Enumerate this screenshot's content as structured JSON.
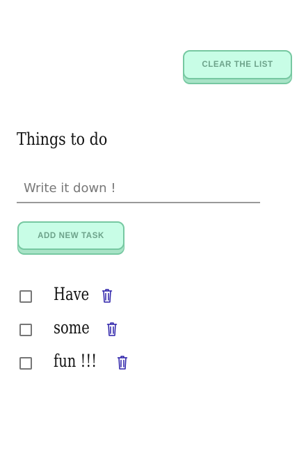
{
  "header": {
    "clear_label": "Clear the list"
  },
  "todo": {
    "title": "Things to do",
    "input": {
      "placeholder": "Write it down !",
      "value": ""
    },
    "add_label": "Add new task",
    "tasks": [
      {
        "text": "Have",
        "checked": false
      },
      {
        "text": "some",
        "checked": false
      },
      {
        "text": "fun !!!",
        "checked": false
      }
    ]
  },
  "colors": {
    "button_bg": "#c8fde6",
    "button_border": "#76c8a1",
    "button_text": "#6da28a",
    "trash_icon": "#2a1fa8"
  },
  "icons": {
    "delete": "trash-icon"
  }
}
